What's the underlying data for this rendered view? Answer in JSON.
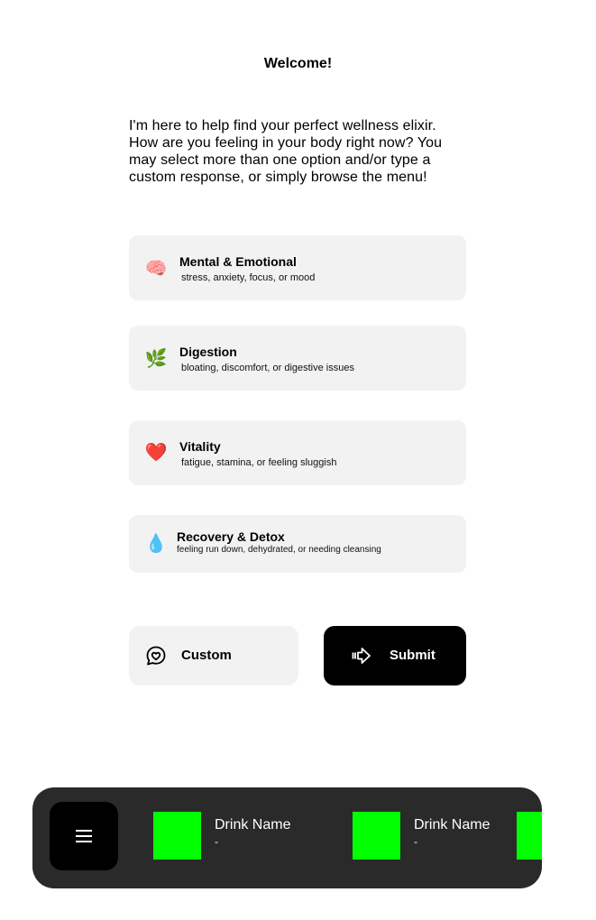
{
  "header": {
    "title": "Welcome!"
  },
  "intro": {
    "lines": [
      "I'm here to help find your perfect wellness elixir.",
      "How are you feeling in your body right now? You",
      "may select more than one option  and/or type a",
      "custom response, or simply browse the menu!"
    ]
  },
  "options": [
    {
      "emoji": "🧠",
      "title": "Mental & Emotional",
      "subtitle": "stress, anxiety, focus, or mood"
    },
    {
      "emoji": "🌿",
      "title": "Digestion",
      "subtitle": "bloating, discomfort, or digestive issues"
    },
    {
      "emoji": "❤️",
      "title": "Vitality",
      "subtitle": "fatigue, stamina, or feeling sluggish"
    },
    {
      "emoji": "💧",
      "title": "Recovery & Detox",
      "subtitle": "feeling run down, dehydrated, or needing cleansing"
    }
  ],
  "actions": {
    "custom_label": "Custom",
    "submit_label": "Submit"
  },
  "bottom_bar": {
    "menu_icon": "hamburger-menu-icon",
    "drinks": [
      {
        "name": "Drink Name",
        "price": "-",
        "color": "#00ff00"
      },
      {
        "name": "Drink Name",
        "price": "-",
        "color": "#00ff00"
      },
      {
        "name": "",
        "price": "",
        "color": "#00ff00"
      }
    ]
  },
  "colors": {
    "accent": "#00ff00",
    "card_bg": "#f2f2f2",
    "bar_bg": "#2a2a2a"
  }
}
